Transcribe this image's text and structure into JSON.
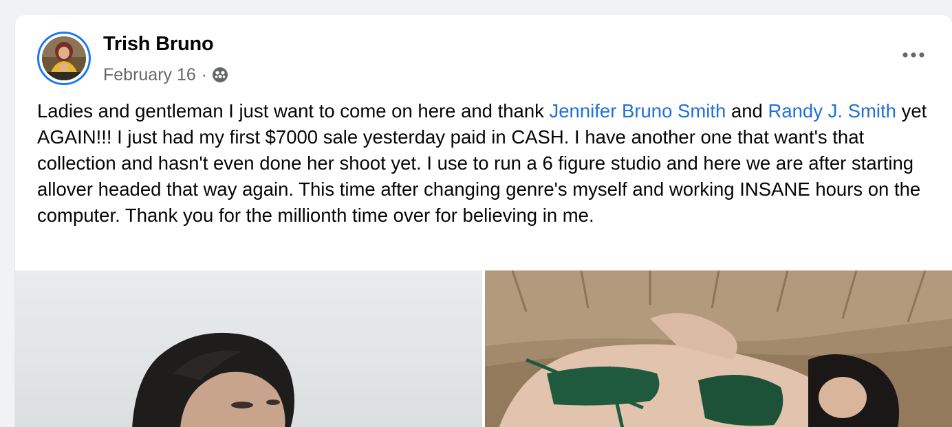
{
  "post": {
    "author": "Trish Bruno",
    "date": "February 16",
    "separator": "·",
    "audience_icon": "friends-icon",
    "more_icon": "more-horizontal-icon",
    "text": {
      "part1": "Ladies and gentleman I just want to come on here and thank ",
      "mention1": "Jennifer Bruno Smith",
      "part2": " and ",
      "mention2": "Randy J. Smith",
      "part3": " yet AGAIN!!! I just had my first $7000 sale yesterday paid in CASH. I have another one that want's that collection and hasn't even done her shoot yet. I use to run a 6 figure studio and here we are after starting allover headed that way again. This time after changing genre's myself and working INSANE hours on the computer. Thank you for the millionth time over for believing in me."
    },
    "photos": [
      {
        "kind": "portrait-photo"
      },
      {
        "kind": "boudoir-photo"
      }
    ]
  },
  "colors": {
    "page_bg": "#f0f2f5",
    "card_bg": "#ffffff",
    "link": "#216fdb",
    "avatar_ring": "#1877f2",
    "secondary_text": "#65676b"
  }
}
